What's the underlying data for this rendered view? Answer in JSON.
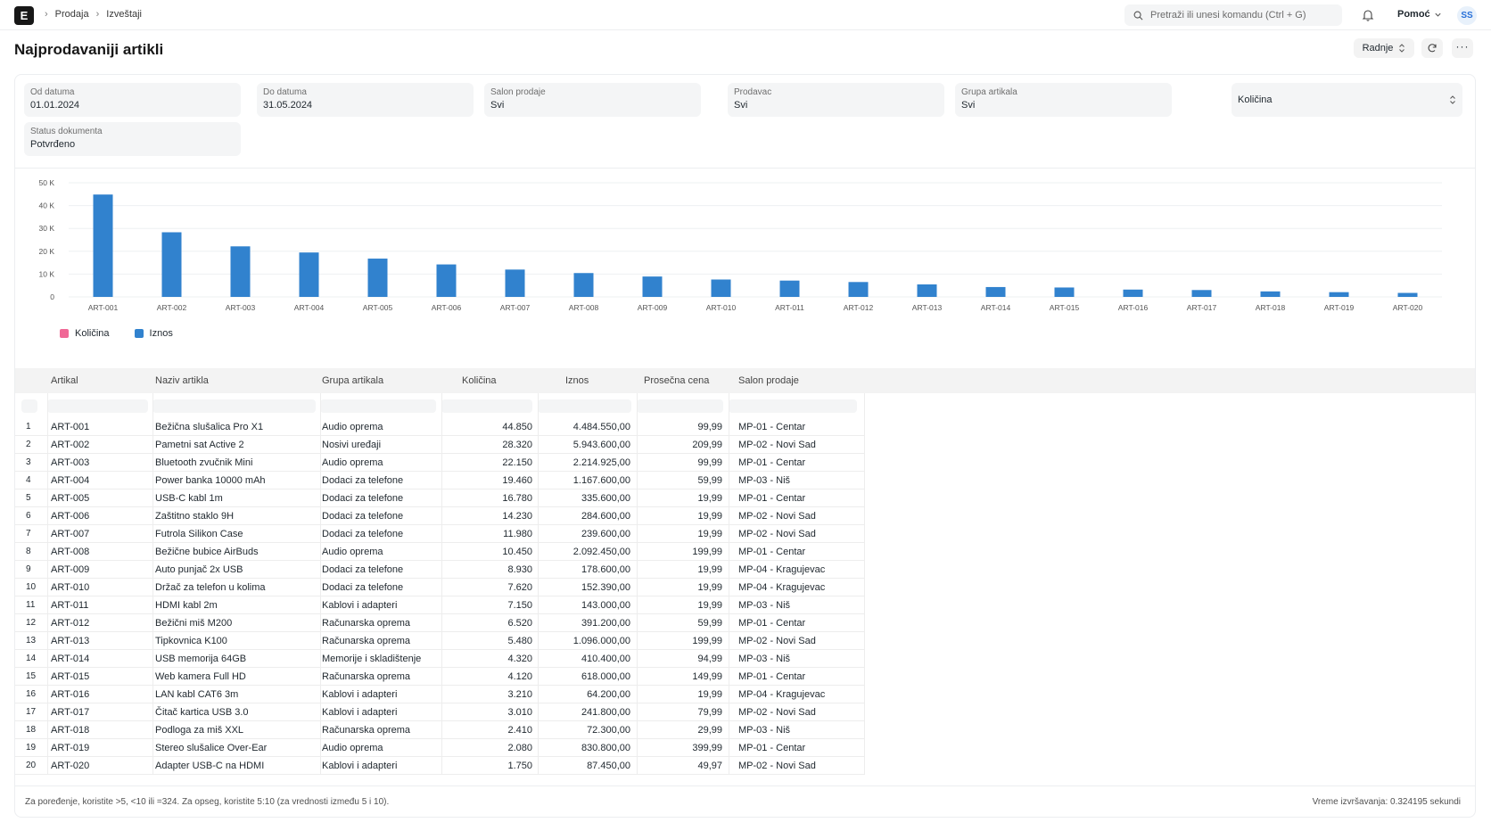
{
  "nav": {
    "logo": "E",
    "breadcrumbs": [
      "Prodaja",
      "Izveštaji"
    ],
    "search_placeholder": "Pretraži ili unesi komandu (Ctrl + G)",
    "help_label": "Pomoć",
    "avatar_initials": "SS"
  },
  "page": {
    "title": "Najprodavaniji artikli",
    "actions_label": "Radnje"
  },
  "filters": [
    {
      "label": "Od datuma",
      "value": "01.01.2024"
    },
    {
      "label": "Do datuma",
      "value": "31.05.2024"
    },
    {
      "label": "Salon prodaje",
      "value": "Svi"
    },
    {
      "label": "Prodavac",
      "value": "Svi"
    },
    {
      "label": "Grupa artikala",
      "value": "Svi"
    },
    {
      "label": "",
      "value": "Količina"
    },
    {
      "label": "Status dokumenta",
      "value": "Potvrđeno"
    }
  ],
  "chart_data": {
    "type": "bar",
    "categories": [
      "ART-001",
      "ART-002",
      "ART-003",
      "ART-004",
      "ART-005",
      "ART-006",
      "ART-007",
      "ART-008",
      "ART-009",
      "ART-010",
      "ART-011",
      "ART-012",
      "ART-013",
      "ART-014",
      "ART-015",
      "ART-016",
      "ART-017",
      "ART-018",
      "ART-019",
      "ART-020"
    ],
    "series": [
      {
        "name": "Količina",
        "color": "#f06896",
        "values": [
          44850,
          28320,
          22150,
          19460,
          16780,
          14230,
          11980,
          10450,
          8930,
          7620,
          7150,
          6520,
          5480,
          4320,
          4120,
          3210,
          3010,
          2410,
          2080,
          1750
        ]
      },
      {
        "name": "Iznos",
        "color": "#3182ce",
        "values": [
          44850,
          28320,
          22150,
          19460,
          16780,
          14230,
          11980,
          10450,
          8930,
          7620,
          7150,
          6520,
          5480,
          4320,
          4120,
          3210,
          3010,
          2410,
          2080,
          1750
        ]
      }
    ],
    "y_ticks": [
      "0",
      "10 K",
      "20 K",
      "30 K",
      "40 K",
      "50 K"
    ],
    "ylim": [
      0,
      50000
    ],
    "legend_position": "bottom-left",
    "grid": true
  },
  "table": {
    "columns": [
      "Artikal",
      "Naziv artikla",
      "Grupa artikala",
      "Količina",
      "Iznos",
      "Prosečna cena",
      "Salon prodaje"
    ],
    "rows": [
      [
        "1",
        "ART-001",
        "Bežična slušalica Pro X1",
        "Audio oprema",
        "44.850",
        "4.484.550,00",
        "99,99",
        "MP-01 - Centar"
      ],
      [
        "2",
        "ART-002",
        "Pametni sat Active 2",
        "Nosivi uređaji",
        "28.320",
        "5.943.600,00",
        "209,99",
        "MP-02 - Novi Sad"
      ],
      [
        "3",
        "ART-003",
        "Bluetooth zvučnik Mini",
        "Audio oprema",
        "22.150",
        "2.214.925,00",
        "99,99",
        "MP-01 - Centar"
      ],
      [
        "4",
        "ART-004",
        "Power banka 10000 mAh",
        "Dodaci za telefone",
        "19.460",
        "1.167.600,00",
        "59,99",
        "MP-03 - Niš"
      ],
      [
        "5",
        "ART-005",
        "USB-C kabl 1m",
        "Dodaci za telefone",
        "16.780",
        "335.600,00",
        "19,99",
        "MP-01 - Centar"
      ],
      [
        "6",
        "ART-006",
        "Zaštitno staklo 9H",
        "Dodaci za telefone",
        "14.230",
        "284.600,00",
        "19,99",
        "MP-02 - Novi Sad"
      ],
      [
        "7",
        "ART-007",
        "Futrola Silikon Case",
        "Dodaci za telefone",
        "11.980",
        "239.600,00",
        "19,99",
        "MP-02 - Novi Sad"
      ],
      [
        "8",
        "ART-008",
        "Bežične bubice AirBuds",
        "Audio oprema",
        "10.450",
        "2.092.450,00",
        "199,99",
        "MP-01 - Centar"
      ],
      [
        "9",
        "ART-009",
        "Auto punjač 2x USB",
        "Dodaci za telefone",
        "8.930",
        "178.600,00",
        "19,99",
        "MP-04 - Kragujevac"
      ],
      [
        "10",
        "ART-010",
        "Držač za telefon u kolima",
        "Dodaci za telefone",
        "7.620",
        "152.390,00",
        "19,99",
        "MP-04 - Kragujevac"
      ],
      [
        "11",
        "ART-011",
        "HDMI kabl 2m",
        "Kablovi i adapteri",
        "7.150",
        "143.000,00",
        "19,99",
        "MP-03 - Niš"
      ],
      [
        "12",
        "ART-012",
        "Bežični miš M200",
        "Računarska oprema",
        "6.520",
        "391.200,00",
        "59,99",
        "MP-01 - Centar"
      ],
      [
        "13",
        "ART-013",
        "Tipkovnica K100",
        "Računarska oprema",
        "5.480",
        "1.096.000,00",
        "199,99",
        "MP-02 - Novi Sad"
      ],
      [
        "14",
        "ART-014",
        "USB memorija 64GB",
        "Memorije i skladištenje",
        "4.320",
        "410.400,00",
        "94,99",
        "MP-03 - Niš"
      ],
      [
        "15",
        "ART-015",
        "Web kamera Full HD",
        "Računarska oprema",
        "4.120",
        "618.000,00",
        "149,99",
        "MP-01 - Centar"
      ],
      [
        "16",
        "ART-016",
        "LAN kabl CAT6 3m",
        "Kablovi i adapteri",
        "3.210",
        "64.200,00",
        "19,99",
        "MP-04 - Kragujevac"
      ],
      [
        "17",
        "ART-017",
        "Čitač kartica USB 3.0",
        "Kablovi i adapteri",
        "3.010",
        "241.800,00",
        "79,99",
        "MP-02 - Novi Sad"
      ],
      [
        "18",
        "ART-018",
        "Podloga za miš XXL",
        "Računarska oprema",
        "2.410",
        "72.300,00",
        "29,99",
        "MP-03 - Niš"
      ],
      [
        "19",
        "ART-019",
        "Stereo slušalice Over-Ear",
        "Audio oprema",
        "2.080",
        "830.800,00",
        "399,99",
        "MP-01 - Centar"
      ],
      [
        "20",
        "ART-020",
        "Adapter USB-C na HDMI",
        "Kablovi i adapteri",
        "1.750",
        "87.450,00",
        "49,97",
        "MP-02 - Novi Sad"
      ]
    ]
  },
  "footer": {
    "hint": "Za poređenje, koristite >5, <10 ili =324. Za opseg, koristite 5:10 (za vrednosti između 5 i 10).",
    "exec_time": "Vreme izvršavanja: 0.324195 sekundi"
  }
}
